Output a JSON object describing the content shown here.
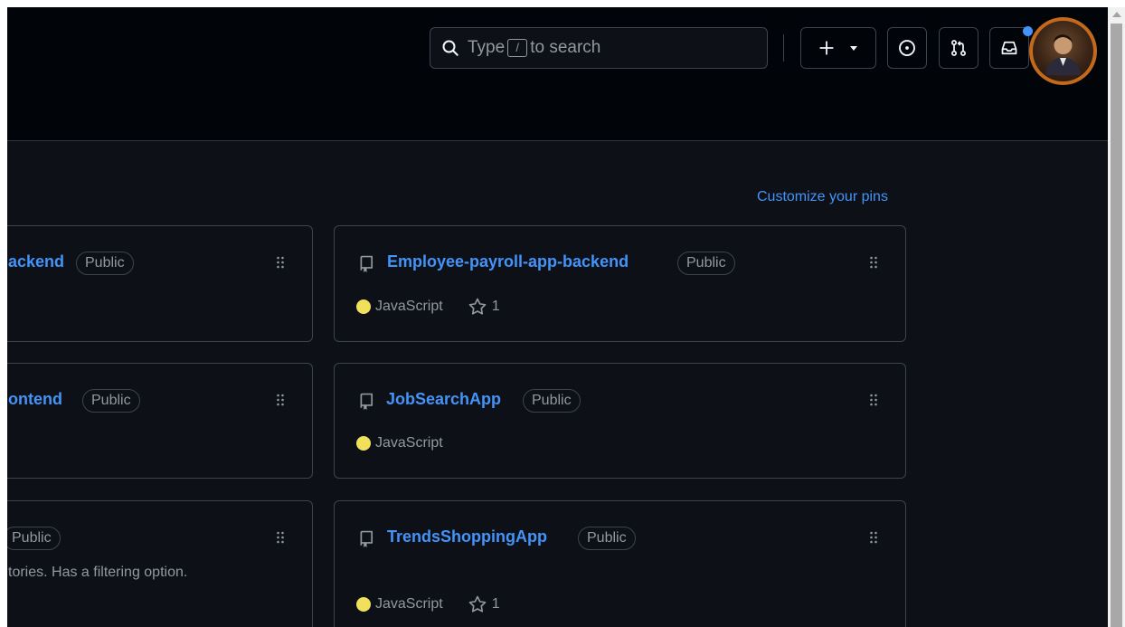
{
  "header": {
    "search": {
      "prefix": "Type",
      "key": "/",
      "suffix": "to search"
    },
    "create_icon": "plus-icon",
    "issues_icon": "issue-opened-icon",
    "pulls_icon": "git-pull-request-icon",
    "inbox_icon": "inbox-icon"
  },
  "pinned": {
    "customize_label": "Customize your pins",
    "cards": [
      {
        "name": "ackend",
        "visibility": "Public"
      },
      {
        "name": "Employee-payroll-app-backend",
        "visibility": "Public",
        "language": "JavaScript",
        "stars": "1"
      },
      {
        "name": "ontend",
        "visibility": "Public"
      },
      {
        "name": "JobSearchApp",
        "visibility": "Public",
        "language": "JavaScript"
      },
      {
        "visibility": "Public",
        "description": "tories. Has a filtering option."
      },
      {
        "name": "TrendsShoppingApp",
        "visibility": "Public",
        "language": "JavaScript",
        "stars": "1"
      }
    ]
  },
  "colors": {
    "accent": "#4493f8",
    "javascript": "#f1e05a",
    "border": "#3d444d",
    "background": "#0d1117",
    "header_bg": "#010409",
    "avatar_ring": "#c2691c"
  }
}
